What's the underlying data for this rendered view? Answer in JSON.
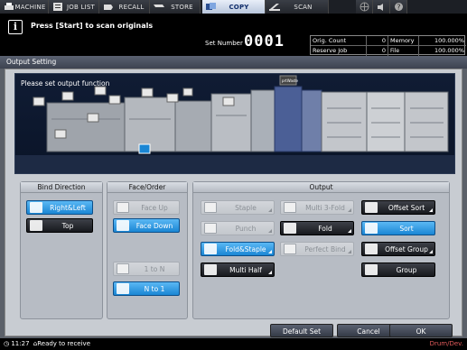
{
  "tabs": [
    {
      "id": "machine",
      "label": "MACHINE",
      "icon": "printer-icon"
    },
    {
      "id": "joblist",
      "label": "JOB LIST",
      "icon": "list-icon"
    },
    {
      "id": "recall",
      "label": "RECALL",
      "icon": "recall-icon"
    },
    {
      "id": "store",
      "label": "STORE",
      "icon": "store-icon"
    },
    {
      "id": "copy",
      "label": "COPY",
      "icon": "copy-icon",
      "active": true
    },
    {
      "id": "scan",
      "label": "SCAN",
      "icon": "scan-icon"
    }
  ],
  "message": {
    "text": "Press [Start] to scan originals"
  },
  "set_number": {
    "label": "Set Number",
    "value": "0001"
  },
  "counters": {
    "orig_count_label": "Orig. Count",
    "orig_count": "0",
    "memory_label": "Memory",
    "memory": "100.000%",
    "reserve_job_label": "Reserve Job",
    "reserve_job": "0",
    "file_amount_label": "File Amount",
    "file_amount": "100.000%"
  },
  "output_setting": {
    "title": "Output Setting",
    "prompt": "Please set output function"
  },
  "bind_direction": {
    "title": "Bind Direction",
    "options": [
      {
        "label": "Right&Left",
        "state": "selected"
      },
      {
        "label": "Top",
        "state": "normal"
      }
    ]
  },
  "face_order": {
    "title": "Face/Order",
    "face_up": "Face Up",
    "face_down": "Face Down",
    "one_to_n": "1 to N",
    "n_to_one": "N to 1"
  },
  "output": {
    "title": "Output",
    "staple": "Staple",
    "multi_3_fold": "Multi 3-Fold",
    "offset_sort": "Offset Sort",
    "punch": "Punch",
    "fold": "Fold",
    "sort": "Sort",
    "fold_staple": "Fold&Staple",
    "perfect_bind": "Perfect Bind",
    "offset_group": "Offset Group",
    "multi_half": "Multi Half",
    "group": "Group"
  },
  "scene_labels": {
    "printer_tag": "prtWaste"
  },
  "footer": {
    "default_set": "Default Set",
    "cancel": "Cancel",
    "ok": "OK"
  },
  "status": {
    "time": "11:27",
    "text": "Ready to receive",
    "right": "Drum/Dev."
  },
  "colors": {
    "accent": "#1a86d4",
    "selected": "#5bb8f4",
    "dark_button": "#23262c"
  }
}
